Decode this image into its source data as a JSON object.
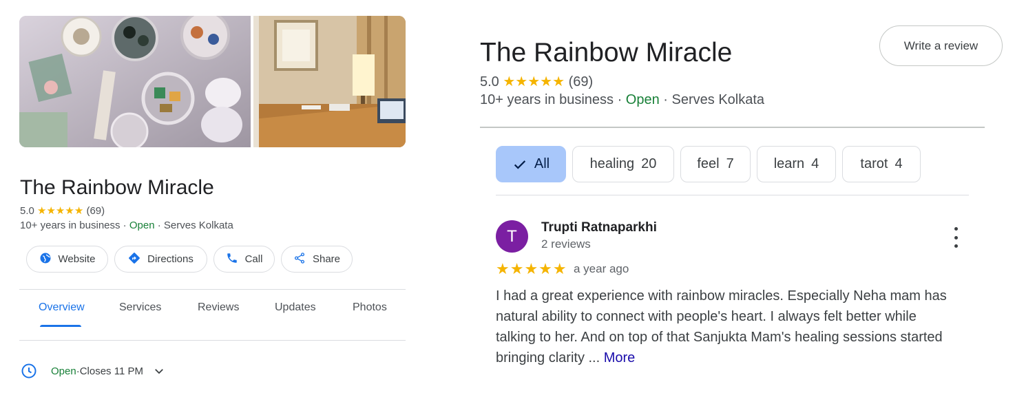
{
  "left_panel": {
    "title": "The Rainbow Miracle",
    "rating": "5.0",
    "stars": "★★★★★",
    "review_count": "(69)",
    "years": "10+ years in business",
    "separator": " · ",
    "status": "Open",
    "serves": "Serves Kolkata",
    "actions": [
      {
        "label": "Website",
        "icon": "globe-icon"
      },
      {
        "label": "Directions",
        "icon": "directions-icon"
      },
      {
        "label": "Call",
        "icon": "phone-icon"
      },
      {
        "label": "Share",
        "icon": "share-icon"
      }
    ],
    "tabs": [
      "Overview",
      "Services",
      "Reviews",
      "Updates",
      "Photos"
    ],
    "active_tab": "Overview",
    "hours": {
      "status": "Open",
      "separator": " · ",
      "closes": "Closes 11 PM",
      "icon": "clock-icon"
    }
  },
  "right_panel": {
    "title": "The Rainbow Miracle",
    "rating": "5.0",
    "stars": "★★★★★",
    "review_count": "(69)",
    "years": "10+ years in business",
    "separator": " · ",
    "status": "Open",
    "serves": "Serves Kolkata",
    "write_review": "Write a review",
    "chips": [
      {
        "label": "All",
        "count": "",
        "selected": true
      },
      {
        "label": "healing",
        "count": "20",
        "selected": false
      },
      {
        "label": "feel",
        "count": "7",
        "selected": false
      },
      {
        "label": "learn",
        "count": "4",
        "selected": false
      },
      {
        "label": "tarot",
        "count": "4",
        "selected": false
      }
    ],
    "review": {
      "avatar_letter": "T",
      "avatar_color": "#7b1fa2",
      "name": "Trupti Ratnaparkhi",
      "count": "2 reviews",
      "stars": "★★★★★",
      "time": "a year ago",
      "text_lines": [
        "I had a great experience with rainbow miracles. Especially Neha mam has",
        "natural ability to connect with people's heart. I always felt better while",
        "talking to her. And on top of that Sanjukta Mam's healing sessions started",
        "bringing clarity ... "
      ],
      "more": "More"
    }
  },
  "colors": {
    "accent": "#1a73e8",
    "open_green": "#188038",
    "star": "#f5b400",
    "chip_selected": "#a8c7fa",
    "link": "#1a0dab"
  }
}
